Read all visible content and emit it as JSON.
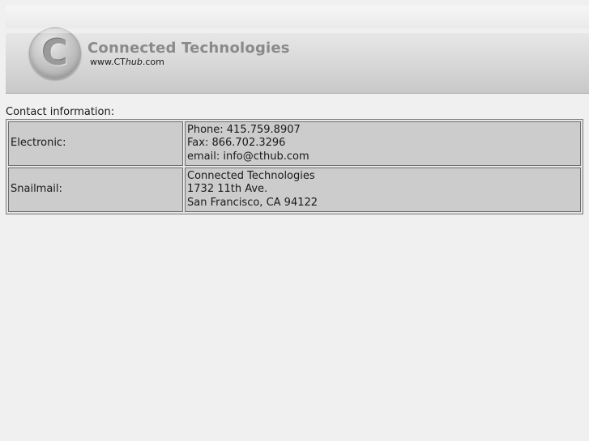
{
  "header": {
    "logo_letter": "C",
    "brand_name": "Connected Technologies",
    "url_prefix": "www.CT",
    "url_hub": "hub",
    "url_suffix": ".com"
  },
  "section": {
    "title": "Contact information:"
  },
  "rows": [
    {
      "label": "Electronic:",
      "lines": [
        "Phone: 415.759.8907",
        "Fax: 866.702.3296",
        "email: info@cthub.com"
      ]
    },
    {
      "label": "Snailmail:",
      "lines": [
        "Connected Technologies",
        "1732 11th Ave.",
        "San Francisco, CA 94122"
      ]
    }
  ]
}
